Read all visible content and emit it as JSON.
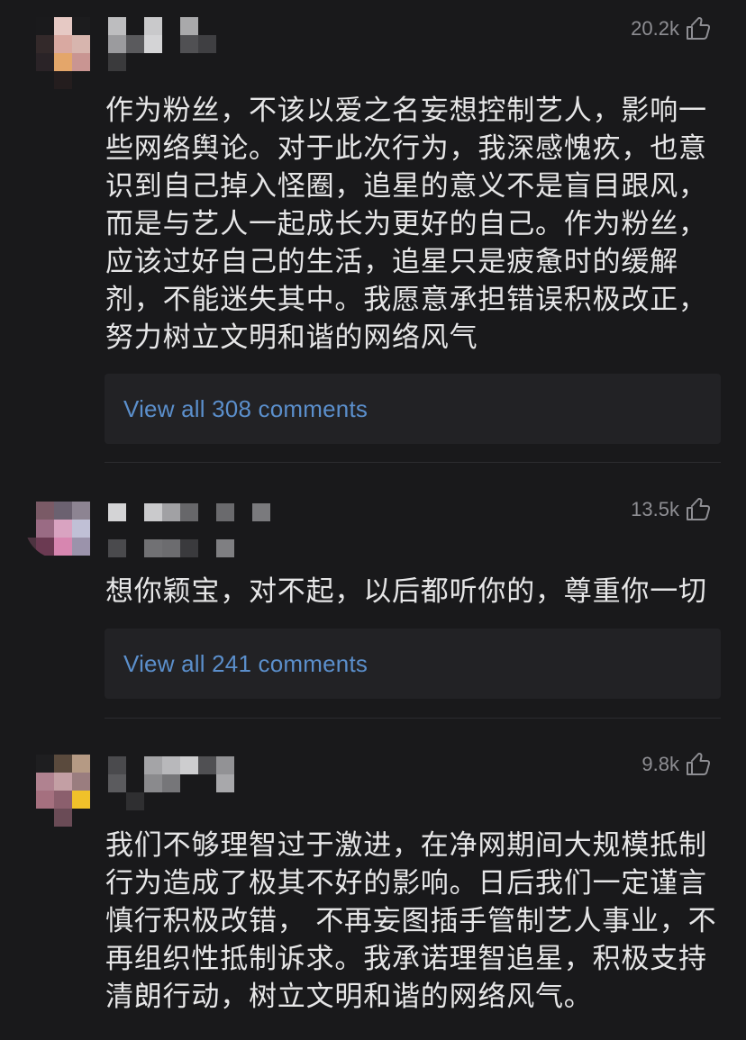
{
  "comments": [
    {
      "likes": "20.2k",
      "text": "作为粉丝，不该以爱之名妄想控制艺人，影响一些网络舆论。对于此次行为，我深感愧疚，也意识到自己掉入怪圈，追星的意义不是盲目跟风，而是与艺人一起成长为更好的自己。作为粉丝，应该过好自己的生活，追星只是疲惫时的缓解剂，不能迷失其中。我愿意承担错误积极改正，努力树立文明和谐的网络风气",
      "replies_label": "View all 308 comments"
    },
    {
      "likes": "13.5k",
      "text": "想你颖宝，对不起，以后都听你的，尊重你一切",
      "replies_label": "View all 241 comments"
    },
    {
      "likes": "9.8k",
      "text": "我们不够理智过于激进，在净网期间大规模抵制行为造成了极其不好的影响。日后我们一定谨言慎行积极改错， 不再妄图插手管制艺人事业，不再组织性抵制诉求。我承诺理智追星，积极支持清朗行动，树立文明和谐的网络风气。"
    }
  ],
  "icons": {
    "like": "thumbs-up-icon"
  },
  "colors": {
    "background": "#19191b",
    "reply_box": "#222225",
    "link": "#5b8fcc",
    "like_count": "#8e8e93"
  }
}
